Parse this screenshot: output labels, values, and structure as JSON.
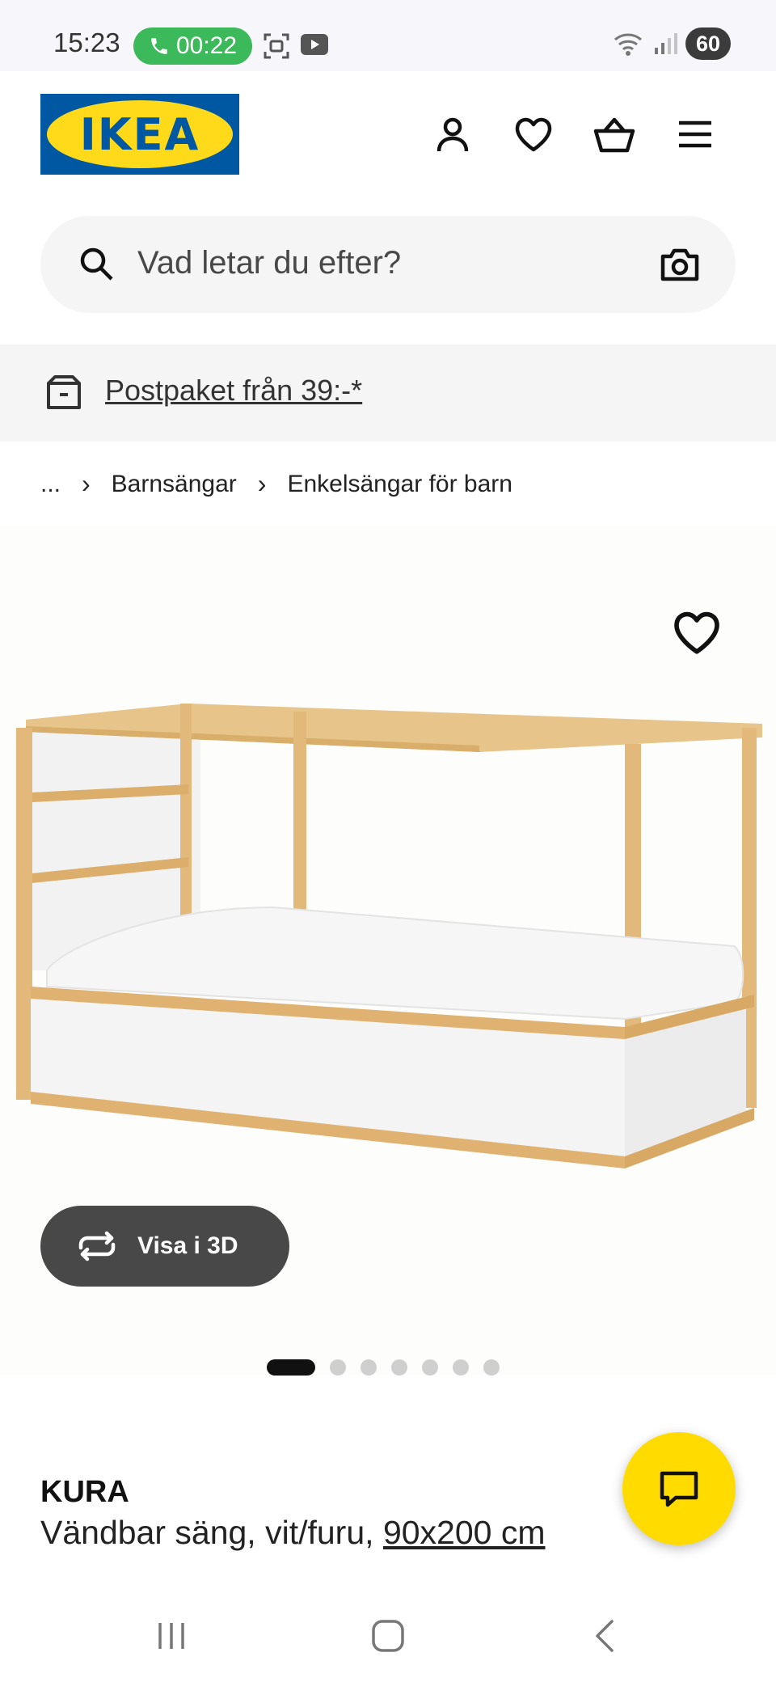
{
  "status_bar": {
    "time": "15:23",
    "call_timer": "00:22",
    "battery": "60",
    "call_color": "#3cb95a"
  },
  "header": {
    "logo_text": "IKEA",
    "brand_blue": "#0058a3",
    "brand_yellow": "#ffda1a",
    "icons": [
      "user-icon",
      "heart-icon",
      "cart-icon",
      "menu-icon"
    ]
  },
  "search": {
    "placeholder": "Vad letar du efter?"
  },
  "banner": {
    "link_text": "Postpaket från 39:-*"
  },
  "breadcrumb": {
    "ellipsis": "...",
    "items": [
      "Barnsängar",
      "Enkelsängar för barn"
    ]
  },
  "product": {
    "view3d_label": "Visa i 3D",
    "carousel": {
      "total": 7,
      "active_index": 0
    },
    "name": "KURA",
    "description": "Vändbar säng, vit/furu,",
    "size": "90x200 cm"
  },
  "chat": {
    "color": "#ffdb00"
  }
}
